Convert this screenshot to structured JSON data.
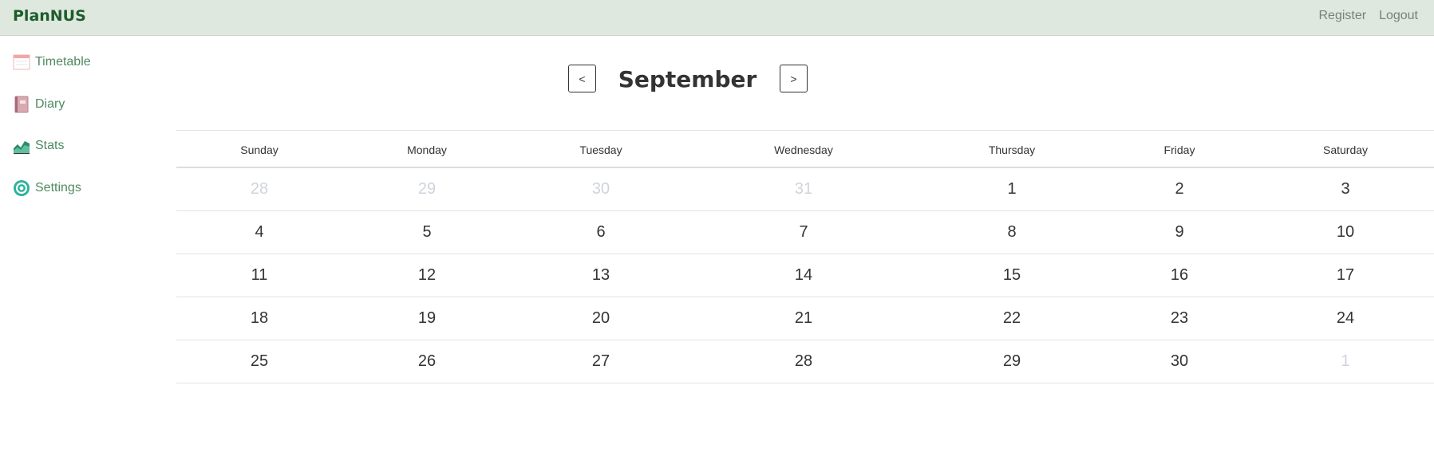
{
  "app": {
    "brand": "PlanNUS"
  },
  "topnav": {
    "register": "Register",
    "logout": "Logout"
  },
  "sidebar": {
    "items": [
      {
        "label": "Timetable",
        "icon": "timetable-icon"
      },
      {
        "label": "Diary",
        "icon": "diary-icon"
      },
      {
        "label": "Stats",
        "icon": "stats-icon"
      },
      {
        "label": "Settings",
        "icon": "settings-icon"
      }
    ]
  },
  "calendar": {
    "month": "September",
    "prev_label": "<",
    "next_label": ">",
    "weekdays": [
      "Sunday",
      "Monday",
      "Tuesday",
      "Wednesday",
      "Thursday",
      "Friday",
      "Saturday"
    ],
    "weeks": [
      [
        {
          "d": "28",
          "muted": true
        },
        {
          "d": "29",
          "muted": true
        },
        {
          "d": "30",
          "muted": true
        },
        {
          "d": "31",
          "muted": true
        },
        {
          "d": "1"
        },
        {
          "d": "2"
        },
        {
          "d": "3"
        }
      ],
      [
        {
          "d": "4"
        },
        {
          "d": "5"
        },
        {
          "d": "6"
        },
        {
          "d": "7"
        },
        {
          "d": "8"
        },
        {
          "d": "9"
        },
        {
          "d": "10"
        }
      ],
      [
        {
          "d": "11"
        },
        {
          "d": "12"
        },
        {
          "d": "13"
        },
        {
          "d": "14"
        },
        {
          "d": "15"
        },
        {
          "d": "16"
        },
        {
          "d": "17"
        }
      ],
      [
        {
          "d": "18"
        },
        {
          "d": "19"
        },
        {
          "d": "20"
        },
        {
          "d": "21"
        },
        {
          "d": "22"
        },
        {
          "d": "23"
        },
        {
          "d": "24"
        }
      ],
      [
        {
          "d": "25"
        },
        {
          "d": "26"
        },
        {
          "d": "27"
        },
        {
          "d": "28"
        },
        {
          "d": "29"
        },
        {
          "d": "30"
        },
        {
          "d": "1",
          "muted": true
        }
      ]
    ]
  },
  "colors": {
    "topbar": "#dfe8de",
    "brand": "#1d5c2c",
    "sidebar_text": "#4f8a5e",
    "muted_day": "#cfd3dc"
  }
}
